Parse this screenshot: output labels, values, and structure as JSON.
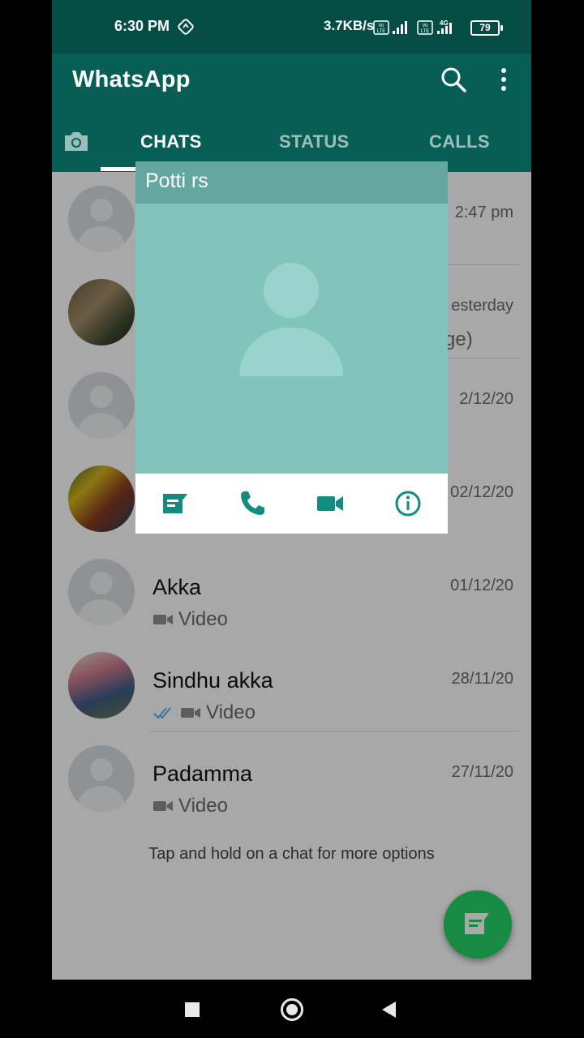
{
  "status_bar": {
    "time": "6:30 PM",
    "net_speed": "3.7KB/s",
    "network_type": "4G",
    "battery": "79"
  },
  "app_bar": {
    "title": "WhatsApp",
    "tabs": [
      {
        "label": "CHATS",
        "active": true
      },
      {
        "label": "STATUS",
        "active": false
      },
      {
        "label": "CALLS",
        "active": false
      }
    ]
  },
  "chats": [
    {
      "name": "",
      "date": "2:47 pm",
      "message": "",
      "avatar": "default"
    },
    {
      "name": "",
      "date": "esterday",
      "message": "ge)",
      "avatar": "photo1"
    },
    {
      "name": "",
      "date": "2/12/20",
      "message": "",
      "avatar": "default"
    },
    {
      "name": "",
      "date": "02/12/20",
      "message": "",
      "avatar": "photo2"
    },
    {
      "name": "Akka",
      "date": "01/12/20",
      "message": "Video",
      "avatar": "default",
      "video_icon": true,
      "ticks": false
    },
    {
      "name": "Sindhu akka",
      "date": "28/11/20",
      "message": "Video",
      "avatar": "photo3",
      "video_icon": true,
      "ticks": true
    },
    {
      "name": "Padamma",
      "date": "27/11/20",
      "message": "Video",
      "avatar": "default",
      "video_icon": true,
      "ticks": false
    }
  ],
  "hint": "Tap and hold on a chat for more options",
  "popup": {
    "contact_name": "Potti rs",
    "actions": [
      "message-icon",
      "call-icon",
      "video-call-icon",
      "info-icon"
    ]
  },
  "colors": {
    "teal_dark": "#075e54",
    "status_bar": "#054d44",
    "accent": "#128c7e",
    "fab": "#25d366",
    "popup_header": "#64a7a0",
    "popup_photo": "#80c4bb"
  }
}
